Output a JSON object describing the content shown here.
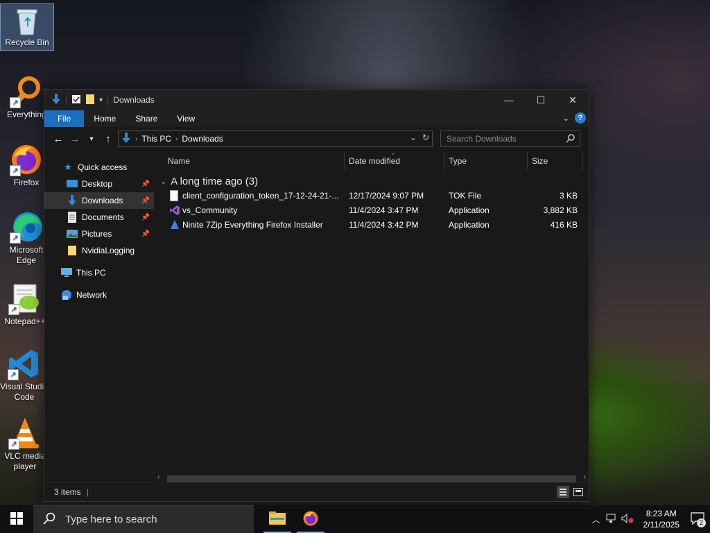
{
  "desktop": {
    "icons": [
      {
        "label": "Recycle Bin"
      },
      {
        "label": "Everything"
      },
      {
        "label": "Firefox"
      },
      {
        "label": "Microsoft Edge"
      },
      {
        "label": "Notepad++"
      },
      {
        "label": "Visual Studio Code"
      },
      {
        "label": "VLC media player"
      }
    ]
  },
  "window": {
    "title": "Downloads",
    "ribbon_tabs": [
      "File",
      "Home",
      "Share",
      "View"
    ],
    "address": {
      "crumbs": [
        "This PC",
        "Downloads"
      ]
    },
    "search": {
      "placeholder": "Search Downloads"
    },
    "nav": {
      "quick_access": "Quick access",
      "items": [
        "Desktop",
        "Downloads",
        "Documents",
        "Pictures",
        "NvidiaLogging"
      ],
      "this_pc": "This PC",
      "network": "Network"
    },
    "columns": [
      "Name",
      "Date modified",
      "Type",
      "Size"
    ],
    "group_label": "A long time ago (3)",
    "files": [
      {
        "name": "client_configuration_token_17-12-24-21-...",
        "date": "12/17/2024 9:07 PM",
        "type": "TOK File",
        "size": "3 KB"
      },
      {
        "name": "vs_Community",
        "date": "11/4/2024 3:47 PM",
        "type": "Application",
        "size": "3,882 KB"
      },
      {
        "name": "Ninite 7Zip Everything Firefox Installer",
        "date": "11/4/2024 3:42 PM",
        "type": "Application",
        "size": "416 KB"
      }
    ],
    "status": "3 items"
  },
  "taskbar": {
    "search_placeholder": "Type here to search",
    "time": "8:23 AM",
    "date": "2/11/2025",
    "notification_count": "2"
  },
  "colors": {
    "accent": "#1a6fbf",
    "window_bg": "#191919",
    "taskbar_bg": "#101013"
  }
}
